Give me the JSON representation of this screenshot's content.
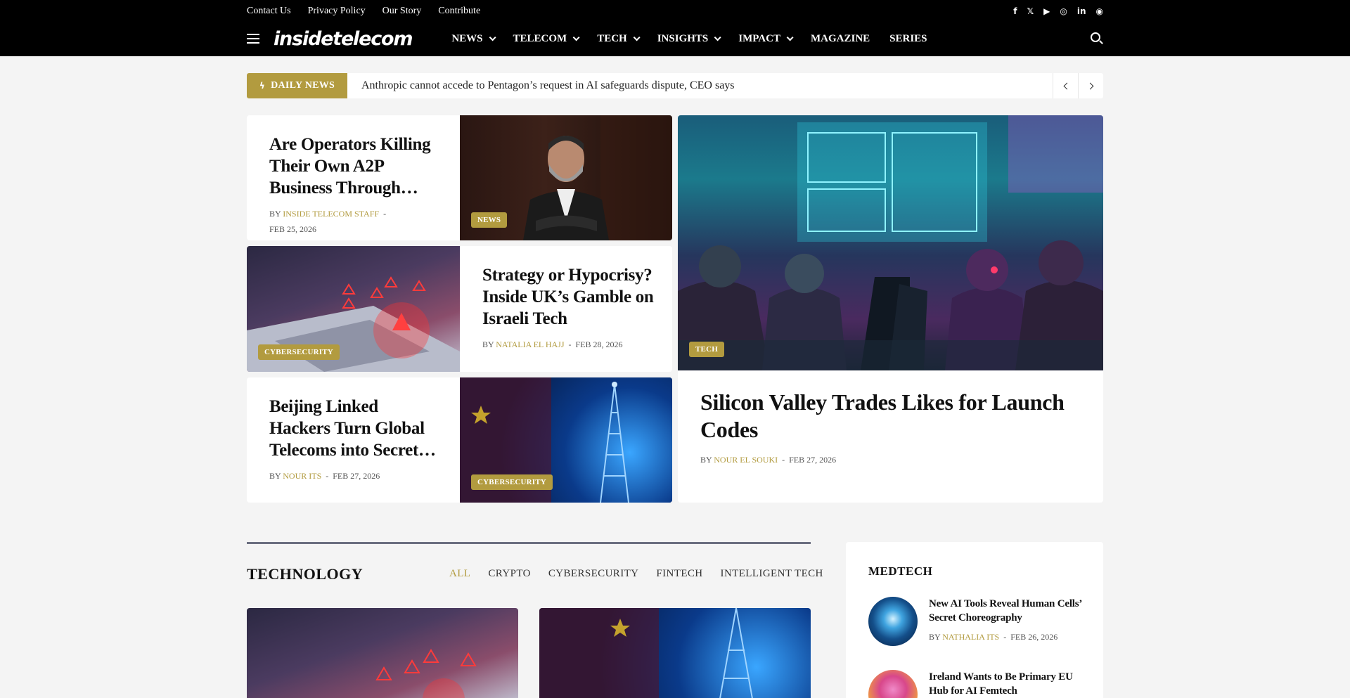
{
  "top_links": [
    "Contact Us",
    "Privacy Policy",
    "Our Story",
    "Contribute"
  ],
  "social": [
    "f",
    "𝕏",
    "▶",
    "◎",
    "in",
    "◉"
  ],
  "social_names": [
    "facebook-icon",
    "x-icon",
    "youtube-icon",
    "instagram-icon",
    "linkedin-icon",
    "whatsapp-icon"
  ],
  "logo": "insidetelecom",
  "nav": [
    {
      "label": "NEWS",
      "dropdown": true
    },
    {
      "label": "TELECOM",
      "dropdown": true
    },
    {
      "label": "TECH",
      "dropdown": true
    },
    {
      "label": "INSIGHTS",
      "dropdown": true
    },
    {
      "label": "IMPACT",
      "dropdown": true
    },
    {
      "label": "MAGAZINE",
      "dropdown": false
    },
    {
      "label": "SERIES",
      "dropdown": false
    }
  ],
  "ticker": {
    "label": "DAILY NEWS",
    "headline": "Anthropic cannot accede to Pentagon’s request in AI safeguards dispute, CEO says"
  },
  "articles": {
    "a1": {
      "title": "Are Operators Killing Their Own A2P Business Through…",
      "by": "BY",
      "author": "INSIDE TELECOM STAFF",
      "date": "FEB 25, 2026",
      "badge": "NEWS"
    },
    "a2": {
      "title": "Strategy or Hypocrisy? Inside UK’s Gamble on Israeli Tech",
      "by": "BY",
      "author": "NATALIA EL HAJJ",
      "date": "FEB 28, 2026",
      "badge": "CYBERSECURITY"
    },
    "a3": {
      "title": "Beijing Linked Hackers Turn Global Telecoms into Secret…",
      "by": "BY",
      "author": "NOUR ITS",
      "date": "FEB 27, 2026",
      "badge": "CYBERSECURITY"
    },
    "feature": {
      "title": "Silicon Valley Trades Likes for Launch Codes",
      "by": "BY",
      "author": "NOUR EL SOUKI",
      "date": "FEB 27, 2026",
      "badge": "TECH"
    }
  },
  "technology": {
    "title": "TECHNOLOGY",
    "tabs": [
      "ALL",
      "CRYPTO",
      "CYBERSECURITY",
      "FINTECH",
      "INTELLIGENT TECH"
    ],
    "active_tab": "ALL"
  },
  "medtech": {
    "title": "MEDTECH",
    "items": [
      {
        "title": "New AI Tools Reveal Human Cells’ Secret Choreography",
        "by": "BY",
        "author": "NATHALIA ITS",
        "date": "FEB 26, 2026"
      },
      {
        "title": "Ireland Wants to Be Primary EU Hub for AI Femtech"
      }
    ]
  },
  "colors": {
    "accent": "#b29b3f",
    "header_bg": "#000000",
    "page_bg": "#f4f4f4"
  }
}
